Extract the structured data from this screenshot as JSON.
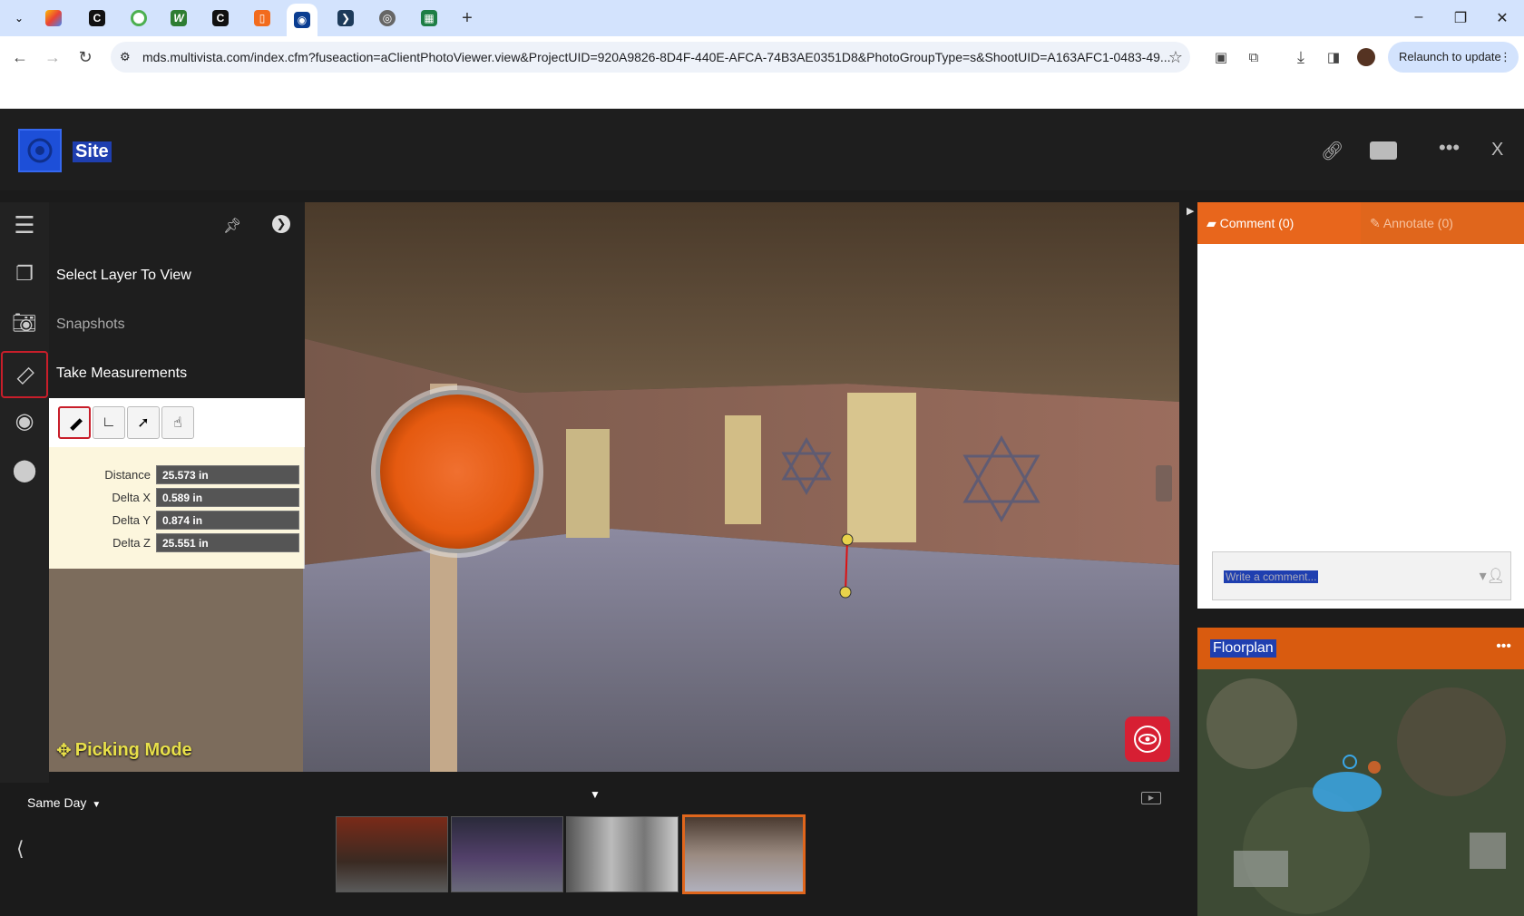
{
  "browser": {
    "url": "mds.multivista.com/index.cfm?fuseaction=aClientPhotoViewer.view&ProjectUID=920A9826-8D4F-440E-AFCA-74B3AE0351D8&PhotoGroupType=s&ShootUID=A163AFC1-0483-49...",
    "relaunch_label": "Relaunch to update",
    "new_tab_label": "+"
  },
  "app": {
    "title": "Site"
  },
  "menu": {
    "items": [
      {
        "label": "Select Layer To View"
      },
      {
        "label": "Snapshots"
      },
      {
        "label": "Take Measurements"
      }
    ]
  },
  "measurements": {
    "rows": [
      {
        "label": "Distance",
        "value": "25.573 in"
      },
      {
        "label": "Delta X",
        "value": "0.589 in"
      },
      {
        "label": "Delta Y",
        "value": "0.874 in"
      },
      {
        "label": "Delta Z",
        "value": "25.551 in"
      }
    ]
  },
  "viewer": {
    "mode_label": "Picking Mode"
  },
  "comments": {
    "comment_tab": "Comment (0)",
    "annotate_tab": "Annotate (0)",
    "placeholder": "Write a comment..."
  },
  "floorplan": {
    "title": "Floorplan"
  },
  "filmstrip": {
    "filter_label": "Same Day"
  },
  "colors": {
    "accent": "#e05a12",
    "brand_red": "#d71f33",
    "highlight_blue": "#1f3fb0"
  }
}
